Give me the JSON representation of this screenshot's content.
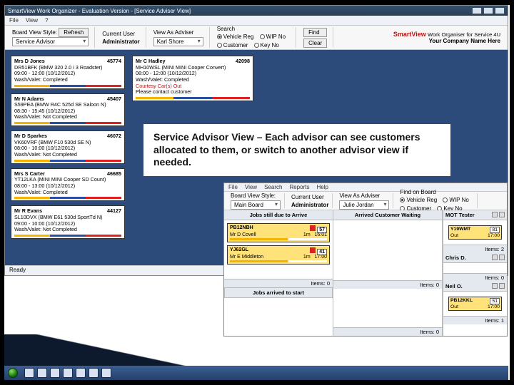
{
  "window": {
    "title": "SmartView Work Organizer - Evaluation Version - [Service Adviser View]",
    "menu": [
      "File",
      "View",
      "?"
    ],
    "status": "Ready"
  },
  "toolbar": {
    "viewstyle_label": "Board View Style:",
    "viewstyle_value": "Service Advisor",
    "refresh": "Refresh",
    "curuser_label": "Current User",
    "curuser_value": "Administrator",
    "viewas_label": "View As Adviser",
    "viewas_value": "Karl Shore",
    "search_label": "Search",
    "r_vehicle": "Vehicle Reg",
    "r_customer": "Customer",
    "r_wip": "WIP No",
    "r_key": "Key No",
    "find": "Find",
    "clear": "Clear"
  },
  "brand": {
    "name": "SmartView",
    "tag": "Work Organiser for Service 4U",
    "company": "Your Company Name Here"
  },
  "cards": [
    {
      "name": "Mrs D Jones",
      "job": "45774",
      "vehicle": "DR51BFK (BMW 320 2.0 i 3 Roadster)",
      "time": "09:00 - 12:00 (10/12/2012)",
      "status": "Wash/Valet: Completed"
    },
    {
      "name": "Mr N Adams",
      "job": "45407",
      "vehicle": "S59PEA (BMW R4C 525d SE Saloon N)",
      "time": "08:30 - 15:45 (10/12/2012)",
      "status": "Wash/Valet: Not Completed"
    },
    {
      "name": "Mr D Sparkes",
      "job": "46072",
      "vehicle": "VK60VRF (BMW F10 530d SE N)",
      "time": "08:00 - 10:00 (10/12/2012)",
      "status": "Wash/Valet: Not Completed"
    },
    {
      "name": "Mrs S Carter",
      "job": "46685",
      "vehicle": "YT12LKA (MINI MINI Cooper SD Count)",
      "time": "08:00 - 13:00 (10/12/2012)",
      "status": "Wash/Valet: Completed"
    },
    {
      "name": "Mr R Evans",
      "job": "44127",
      "vehicle": "SL10DVX (BMW E61 530d SportTd N)",
      "time": "09:00 - 10:00 (10/12/2012)",
      "status": "Wash/Valet: Not Completed"
    }
  ],
  "card_right": {
    "name": "Mr C Hadley",
    "job": "42098",
    "vehicle": "MH10WSL (MINI MINI Cooper Convert)",
    "time": "08:00 - 12:00 (10/12/2012)",
    "status": "Wash/Valet: Completed",
    "status2": "Courtesy Car(s) Out",
    "status3": "Please contact customer"
  },
  "caption": "Service Advisor View – Each advisor can see customers allocated to them, or switch to another advisor view if needed.",
  "inset": {
    "menu": [
      "File",
      "View",
      "Search",
      "Reports",
      "Help"
    ],
    "toolbar": {
      "viewstyle_label": "Board View Style:",
      "viewstyle_value": "Main Board",
      "curuser_label": "Current User",
      "curuser_value": "Administrator",
      "viewas_label": "View As Adviser",
      "viewas_value": "Julie Jordan",
      "find_label": "Find on Board",
      "r_vehicle": "Vehicle Reg",
      "r_customer": "Customer",
      "r_wip": "WIP No",
      "r_key": "Key No"
    },
    "cols": {
      "left": {
        "header": "Jobs still due to Arrive",
        "footer": "Items: 0",
        "tickets": [
          {
            "reg": "PB12NBH",
            "job": "57",
            "name": "Mr D Covell",
            "dur": "1m",
            "tm": "16:01"
          },
          {
            "reg": "YJ62GL",
            "job": "41",
            "name": "Mr E Middleton",
            "dur": "1m",
            "tm": "17:00"
          }
        ],
        "subheader": "Jobs arrived to start"
      },
      "mid": {
        "header": "Arrived Customer Waiting",
        "footer": "Items: 0",
        "footer2": "Items: 0"
      },
      "side": [
        {
          "title": "MOT Tester",
          "ticket": {
            "reg": "Y19WMT",
            "job": "81",
            "out": "Out",
            "tm": "17:00"
          },
          "footer": "Items: 2"
        },
        {
          "title": "Chris D.",
          "footer": "Items: 0"
        },
        {
          "title": "Neil O.",
          "ticket": {
            "reg": "PB12KKL",
            "job": "51",
            "out": "Out",
            "tm": "17:00"
          },
          "footer": "Items: 1"
        }
      ]
    }
  }
}
